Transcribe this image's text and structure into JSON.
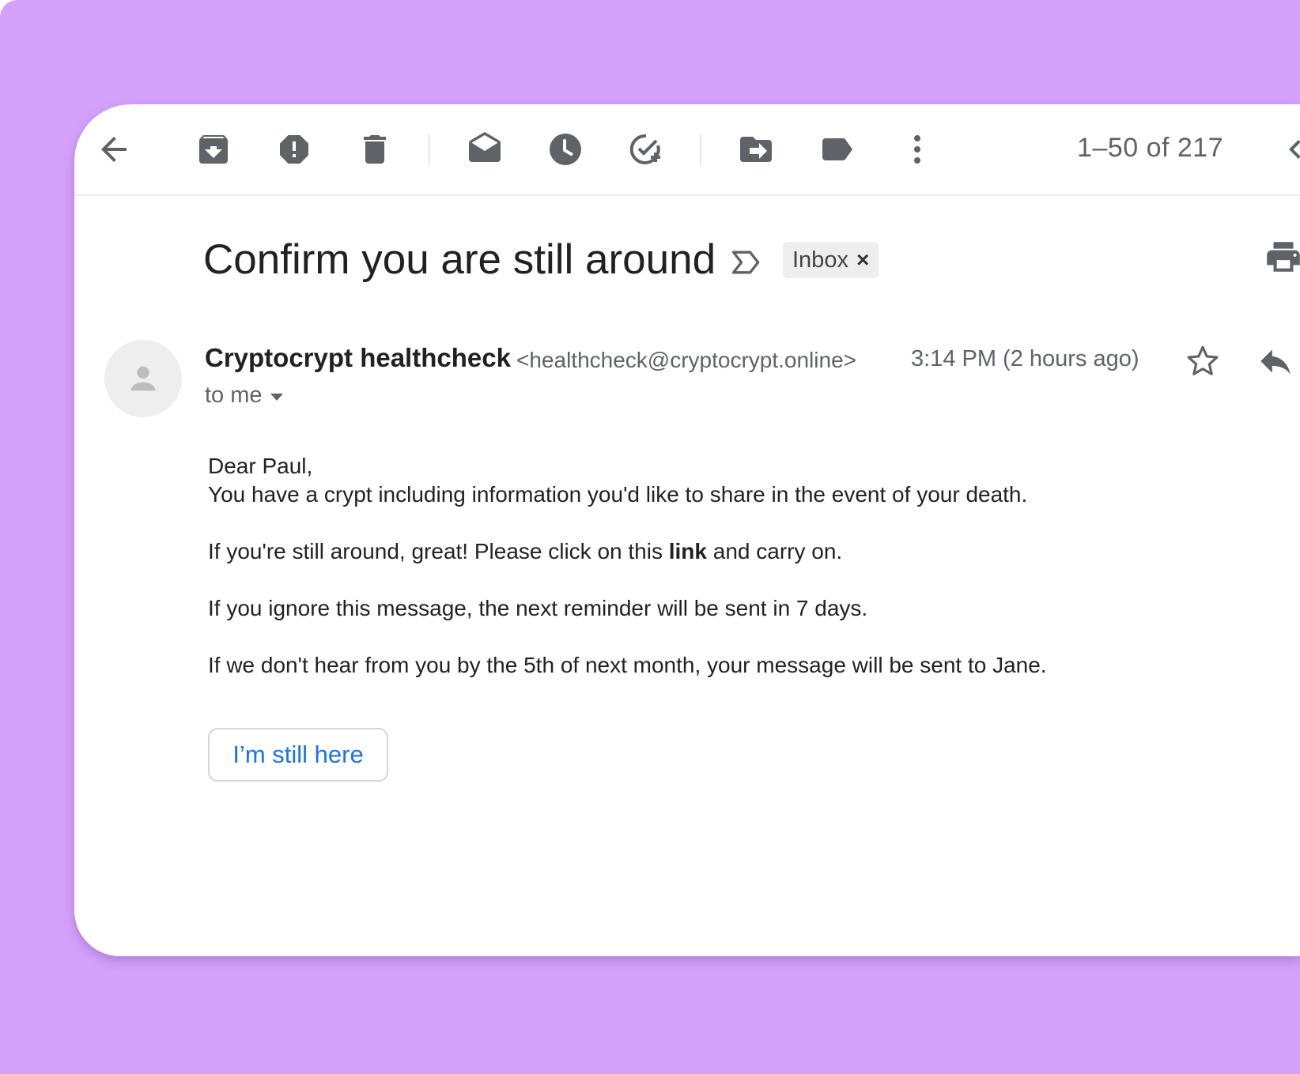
{
  "toolbar": {
    "icons": [
      "back-arrow-icon",
      "archive-icon",
      "report-spam-icon",
      "delete-icon",
      "mark-unread-icon",
      "snooze-icon",
      "add-task-icon",
      "move-to-icon",
      "label-icon",
      "more-icon",
      "chevron-left-icon"
    ],
    "pager": "1–50 of 217"
  },
  "email": {
    "subject": "Confirm you are still around",
    "label": "Inbox",
    "label_remove": "×",
    "sender_name": "Cryptocrypt healthcheck",
    "sender_email": "<healthcheck@cryptocrypt.online>",
    "time": "3:14 PM (2 hours ago)",
    "recipient": "to me",
    "body": {
      "greeting": "Dear Paul,",
      "line1": "You have a crypt including information you'd like to share in the event of your death.",
      "line2_before": "If you're still around, great! Please click on this ",
      "line2_link": "link",
      "line2_after": " and carry on.",
      "line3": "If you ignore this message, the next reminder will be sent in 7 days.",
      "line4": "If we don't hear from you by the 5th of next month, your message will be sent to Jane."
    },
    "cta_label": "I’m still here"
  },
  "colors": {
    "background": "#d4a1fb",
    "card": "#ffffff",
    "accent": "#1a73e8",
    "icon": "#5f6368"
  }
}
